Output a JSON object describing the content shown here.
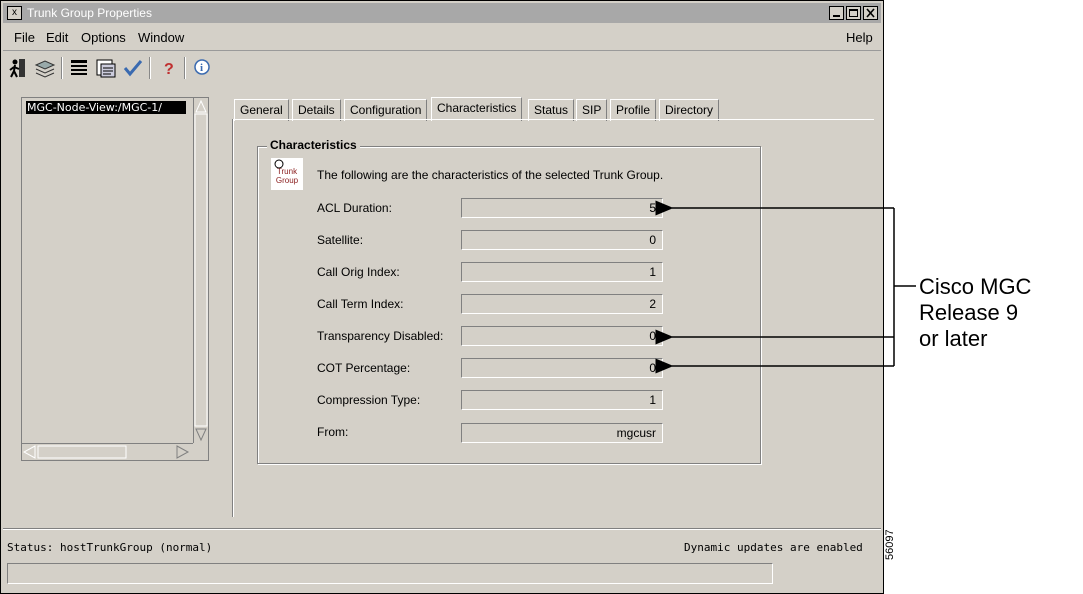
{
  "window": {
    "title": "Trunk Group Properties",
    "sys_icon": "x"
  },
  "menu": {
    "file": "File",
    "edit": "Edit",
    "options": "Options",
    "window": "Window",
    "help": "Help"
  },
  "toolbar": {
    "icons": [
      "exit-icon",
      "layers-icon",
      "list-icon",
      "properties-icon",
      "check-icon",
      "help-icon",
      "info-icon"
    ]
  },
  "tree": {
    "selected_item": "MGC-Node-View:/MGC-1/"
  },
  "tabs": [
    {
      "label": "General"
    },
    {
      "label": "Details"
    },
    {
      "label": "Configuration"
    },
    {
      "label": "Characteristics",
      "active": true
    },
    {
      "label": "Status"
    },
    {
      "label": "SIP"
    },
    {
      "label": "Profile"
    },
    {
      "label": "Directory"
    }
  ],
  "characteristics": {
    "legend": "Characteristics",
    "icon_text_line1": "Trunk",
    "icon_text_line2": "Group",
    "description": "The following are the characteristics of the selected Trunk Group.",
    "fields": [
      {
        "label": "ACL Duration:",
        "value": "5"
      },
      {
        "label": "Satellite:",
        "value": "0"
      },
      {
        "label": "Call Orig Index:",
        "value": "1"
      },
      {
        "label": "Call Term Index:",
        "value": "2"
      },
      {
        "label": "Transparency Disabled:",
        "value": "0"
      },
      {
        "label": "COT Percentage:",
        "value": "0"
      },
      {
        "label": "Compression Type:",
        "value": "1"
      },
      {
        "label": "From:",
        "value": "mgcusr"
      }
    ]
  },
  "status": {
    "left": "Status: hostTrunkGroup (normal)",
    "right": "Dynamic updates are enabled"
  },
  "annotation": {
    "line1": "Cisco MGC",
    "line2": "Release 9",
    "line3": "or later",
    "figure_number": "56097"
  }
}
